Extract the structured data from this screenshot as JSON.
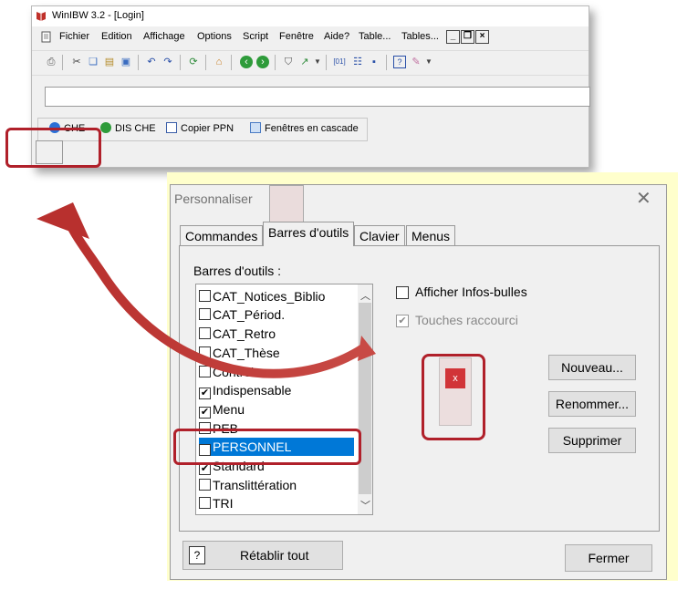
{
  "window": {
    "title": "WinIBW 3.2 - [Login]",
    "menus": [
      "Fichier",
      "Edition",
      "Affichage",
      "Options",
      "Script",
      "Fenêtre",
      "Aide?",
      "Table...",
      "Tables..."
    ],
    "toolbar2_items": [
      {
        "label": "CHE",
        "icon": "globe-blue-icon",
        "color": "#2a6fd6"
      },
      {
        "label": "DIS CHE",
        "icon": "globe-green-icon",
        "color": "#2e9b3a"
      },
      {
        "label": "Copier PPN",
        "icon": "checkbox-doc-icon",
        "color": "#3b5ea8"
      },
      {
        "label": "Fenêtres en cascade",
        "icon": "cascade-windows-icon",
        "color": "#4a7bc4"
      }
    ]
  },
  "dialog": {
    "title": "Personnaliser",
    "tabs": [
      "Commandes",
      "Barres d'outils",
      "Clavier",
      "Menus"
    ],
    "active_tab": "Barres d'outils",
    "list_label": "Barres d'outils :",
    "toolbars": [
      {
        "name": "CAT_Notices_Biblio",
        "checked": false
      },
      {
        "name": "CAT_Périod.",
        "checked": false
      },
      {
        "name": "CAT_Retro",
        "checked": false
      },
      {
        "name": "CAT_Thèse",
        "checked": false
      },
      {
        "name": "Contrôle",
        "checked": false
      },
      {
        "name": "Indispensable",
        "checked": true
      },
      {
        "name": "Menu",
        "checked": true
      },
      {
        "name": "PEB",
        "checked": false
      },
      {
        "name": "PERSONNEL",
        "checked": true,
        "selected": true
      },
      {
        "name": "Standard",
        "checked": true
      },
      {
        "name": "Translittération",
        "checked": false
      },
      {
        "name": "TRI",
        "checked": false
      }
    ],
    "options": {
      "tooltips": {
        "label": "Afficher Infos-bulles",
        "checked": false
      },
      "shortcuts": {
        "label": "Touches raccourci",
        "checked": true,
        "disabled": true
      }
    },
    "buttons": {
      "new": "Nouveau...",
      "rename": "Renommer...",
      "delete": "Supprimer",
      "reset": "Rétablir tout",
      "close": "Fermer"
    },
    "preview_close_glyph": "x"
  },
  "colors": {
    "highlight": "#b0202a",
    "selection": "#0078d7",
    "dialog_bg": "#f0f0f0",
    "shadow_bg": "#ffffcc"
  }
}
